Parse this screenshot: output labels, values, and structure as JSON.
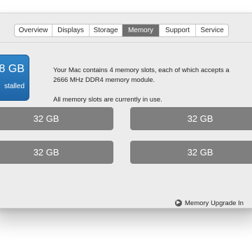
{
  "tabs": [
    {
      "label": "Overview",
      "active": false
    },
    {
      "label": "Displays",
      "active": false
    },
    {
      "label": "Storage",
      "active": false
    },
    {
      "label": "Memory",
      "active": true
    },
    {
      "label": "Support",
      "active": false
    },
    {
      "label": "Service",
      "active": false
    }
  ],
  "summary": {
    "size": "8 GB",
    "label": "stalled"
  },
  "info": {
    "slots_text": "Your Mac contains 4 memory slots, each of which accepts a 2666 MHz DDR4 memory module.",
    "status_text": "All memory slots are currently in use."
  },
  "slots": [
    {
      "label": "32 GB"
    },
    {
      "label": "32 GB"
    },
    {
      "label": "32 GB"
    },
    {
      "label": "32 GB"
    }
  ],
  "upgrade": {
    "icon": "arrow-right-circle-icon",
    "label": "Memory Upgrade In"
  },
  "colors": {
    "active_tab": "#6f6f6f",
    "badge": "#2a7bbf",
    "slot": "#7f7f7f"
  }
}
